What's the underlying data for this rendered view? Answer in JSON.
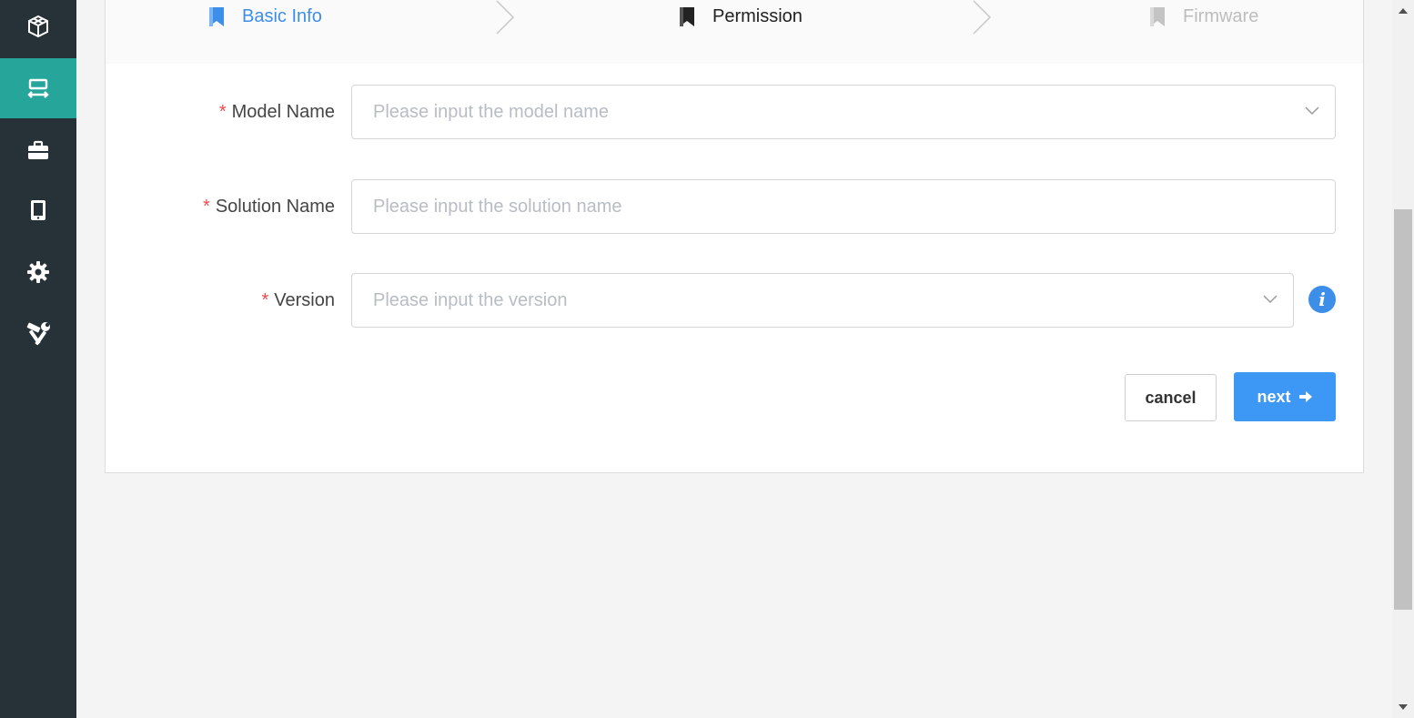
{
  "sidebar": {
    "items": [
      {
        "name": "models",
        "icon": "cube-icon",
        "active": false
      },
      {
        "name": "solutions",
        "icon": "transfer-icon",
        "active": true
      },
      {
        "name": "projects",
        "icon": "briefcase-icon",
        "active": false
      },
      {
        "name": "devices",
        "icon": "tablet-icon",
        "active": false
      },
      {
        "name": "settings",
        "icon": "gear-icon",
        "active": false
      },
      {
        "name": "tools",
        "icon": "tools-icon",
        "active": false
      }
    ],
    "active_color": "#26a69a",
    "background": "#263238"
  },
  "steps": [
    {
      "label": "Basic Info",
      "state": "done",
      "icon": "bookmark-icon"
    },
    {
      "label": "Permission",
      "state": "current",
      "icon": "bookmark-icon"
    },
    {
      "label": "Firmware",
      "state": "todo",
      "icon": "bookmark-icon"
    }
  ],
  "form": {
    "model_name": {
      "required_mark": "*",
      "label": "Model Name",
      "placeholder": "Please input the model name",
      "value": ""
    },
    "solution_name": {
      "required_mark": "*",
      "label": "Solution Name",
      "placeholder": "Please input the solution name",
      "value": ""
    },
    "version": {
      "required_mark": "*",
      "label": "Version",
      "placeholder": "Please input the version",
      "value": ""
    }
  },
  "buttons": {
    "cancel": "cancel",
    "next": "next"
  },
  "colors": {
    "accent": "#3d97f5",
    "required": "#f04a4a"
  }
}
